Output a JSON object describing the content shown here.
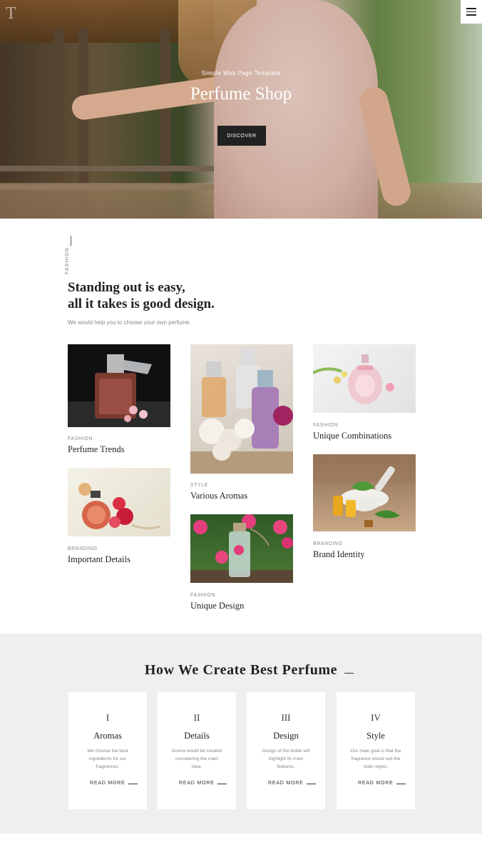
{
  "header": {
    "logo": "T",
    "menu_icon": "hamburger-icon"
  },
  "hero": {
    "subtitle": "Simple Web Page Template",
    "title": "Perfume Shop",
    "button_label": "DISCOVER"
  },
  "intro": {
    "vertical_tag": "FASHION",
    "title_line1": "Standing out is easy,",
    "title_line2": "all it takes is good design.",
    "text": "We would help you to choose your own perfume."
  },
  "gallery": [
    {
      "category": "FASHION",
      "title": "Perfume Trends"
    },
    {
      "category": "BRANDING",
      "title": "Important Details"
    },
    {
      "category": "STYLE",
      "title": "Various Aromas"
    },
    {
      "category": "FASHION",
      "title": "Unique Design"
    },
    {
      "category": "FASHION",
      "title": "Unique Combinations"
    },
    {
      "category": "BRANDING",
      "title": "Brand Identity"
    }
  ],
  "process": {
    "title": "How We Create Best Perfume",
    "steps": [
      {
        "numeral": "I",
        "title": "Aromas",
        "text": "We choose the best ingredients for our fragrances.",
        "link": "READ MORE"
      },
      {
        "numeral": "II",
        "title": "Details",
        "text": "Aroma would be created considering the main idea.",
        "link": "READ MORE"
      },
      {
        "numeral": "III",
        "title": "Design",
        "text": "Design of the bottle will highlight its main features.",
        "link": "READ MORE"
      },
      {
        "numeral": "IV",
        "title": "Style",
        "text": "Our main goal is that the fragrance would suit the main styles.",
        "link": "READ MORE"
      }
    ]
  },
  "colors": {
    "dark": "#222222",
    "muted_text": "#888888",
    "process_bg": "#efefef"
  }
}
